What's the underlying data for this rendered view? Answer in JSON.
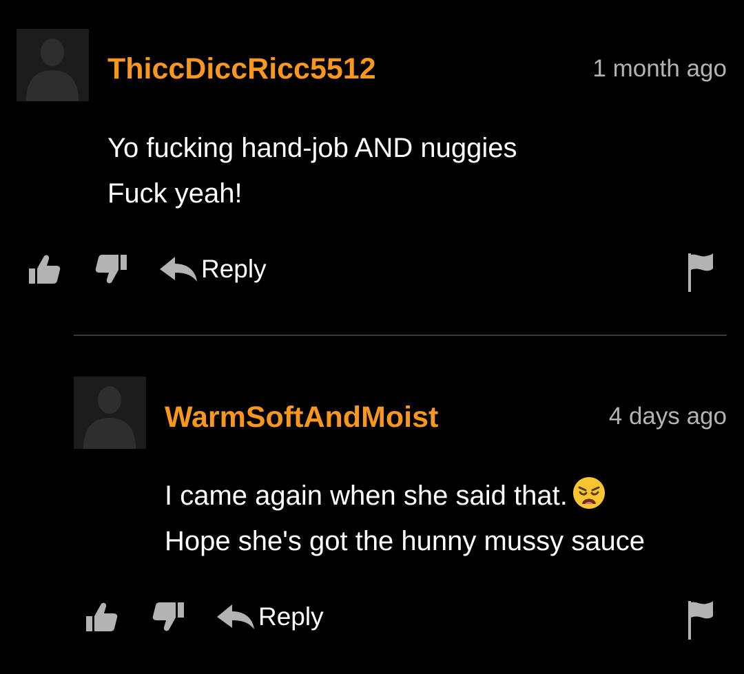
{
  "theme": {
    "background": "#000000",
    "username_color": "#f7971d",
    "timestamp_color": "#b3b3b3",
    "icon_color": "#b3b3b3",
    "text_color": "#ffffff",
    "divider_color": "#3a3a3a"
  },
  "comments": [
    {
      "username": "ThiccDiccRicc5512",
      "timestamp": "1 month ago",
      "lines": [
        "Yo fucking hand-job AND nuggies",
        "Fuck yeah!"
      ],
      "emoji": null,
      "reply_label": "Reply",
      "icons": [
        "avatar-placeholder-icon",
        "thumbs-up-icon",
        "thumbs-down-icon",
        "reply-arrow-icon",
        "flag-icon"
      ]
    },
    {
      "username": "WarmSoftAndMoist",
      "timestamp": "4 days ago",
      "lines": [
        "I came again when she said that.",
        "Hope she's got the hunny mussy sauce"
      ],
      "emoji": "weary-face-emoji",
      "reply_label": "Reply",
      "icons": [
        "avatar-placeholder-icon",
        "thumbs-up-icon",
        "thumbs-down-icon",
        "reply-arrow-icon",
        "flag-icon"
      ]
    }
  ]
}
